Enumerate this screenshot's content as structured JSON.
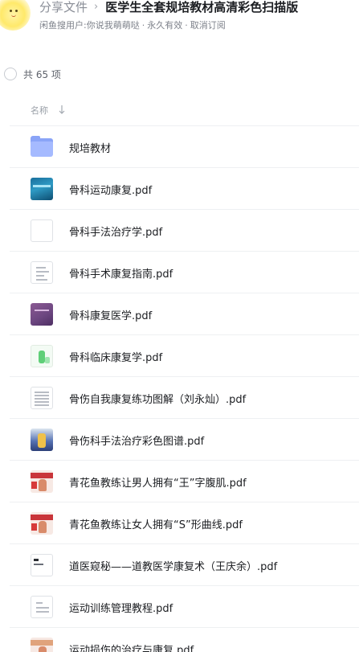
{
  "header": {
    "breadcrumb_root": "分享文件",
    "breadcrumb_separator": "›",
    "title": "医学生全套规培教材高清彩色扫描版",
    "sharer": "闲鱼搜用户:你说我萌萌哒",
    "expiry": "永久有效",
    "unsubscribe": "取消订阅",
    "separator": "·"
  },
  "selection": {
    "count_label": "共 65 项"
  },
  "columns": {
    "name_label": "名称",
    "sort_icon": "arrow-down-icon"
  },
  "files": [
    {
      "name": "规培教材",
      "type": "folder",
      "icon": "folder-icon"
    },
    {
      "name": "骨科运动康复.pdf",
      "type": "pdf",
      "icon": "cover-blue"
    },
    {
      "name": "骨科手法治疗学.pdf",
      "type": "pdf",
      "icon": "cover-blank"
    },
    {
      "name": "骨科手术康复指南.pdf",
      "type": "pdf",
      "icon": "cover-doc"
    },
    {
      "name": "骨科康复医学.pdf",
      "type": "pdf",
      "icon": "cover-purple"
    },
    {
      "name": "骨科临床康复学.pdf",
      "type": "pdf",
      "icon": "cover-green"
    },
    {
      "name": "骨伤自我康复练功图解（刘永灿）.pdf",
      "type": "pdf",
      "icon": "cover-form"
    },
    {
      "name": "骨伤科手法治疗彩色图谱.pdf",
      "type": "pdf",
      "icon": "cover-yellow"
    },
    {
      "name": "青花鱼教练让男人拥有“王”字腹肌.pdf",
      "type": "pdf",
      "icon": "cover-red"
    },
    {
      "name": "青花鱼教练让女人拥有“S”形曲线.pdf",
      "type": "pdf",
      "icon": "cover-red"
    },
    {
      "name": "道医窥秘——道教医学康复术（王庆余）.pdf",
      "type": "pdf",
      "icon": "cover-plain"
    },
    {
      "name": "运动训练管理教程.pdf",
      "type": "pdf",
      "icon": "cover-doc"
    },
    {
      "name": "运动损伤的治疗与康复.pdf",
      "type": "pdf",
      "icon": "cover-red"
    }
  ]
}
